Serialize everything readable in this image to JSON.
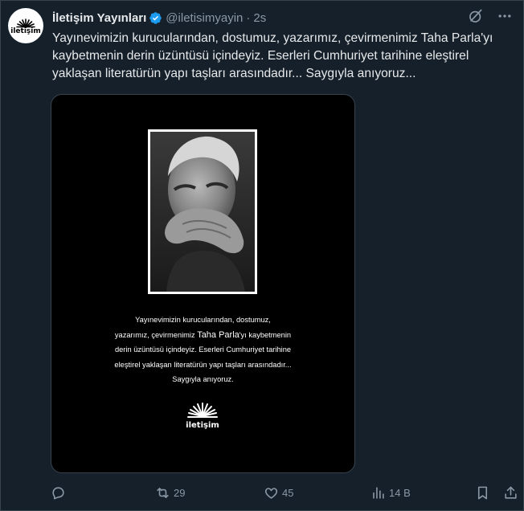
{
  "author": {
    "display_name": "İletişim Yayınları",
    "handle": "@iletisimyayin",
    "separator": "·",
    "time": "2s",
    "avatar_label": "iletişim"
  },
  "tweet": {
    "text": "Yayınevimizin kurucularından, dostumuz, yazarımız, çevirmenimiz Taha Parla'yı kaybetmenin derin üzüntüsü içindeyiz. Eserleri Cumhuriyet tarihine eleştirel yaklaşan literatürün yapı taşları arasındadır... Saygıyla anıyoruz..."
  },
  "media": {
    "caption_line1": "Yayınevimizin kurucularından, dostumuz,",
    "caption_line2_pre": "yazarımız, çevirmenimiz ",
    "caption_line2_name": "Taha Parla",
    "caption_line2_post": "'yı kaybetmenin",
    "caption_line3": "derin üzüntüsü içindeyiz. Eserleri Cumhuriyet tarihine",
    "caption_line4": "eleştirel yaklaşan literatürün yapı taşları arasındadır...",
    "caption_line5": "Saygıyla anıyoruz.",
    "logo_label": "iletişim"
  },
  "actions": {
    "replies": "",
    "retweets": "29",
    "likes": "45",
    "views": "14 B"
  },
  "icons": {
    "verified": "verified-badge-icon",
    "grok": "grok-icon",
    "more": "more-icon",
    "reply": "reply-icon",
    "retweet": "retweet-icon",
    "like": "heart-icon",
    "views": "views-icon",
    "bookmark": "bookmark-icon",
    "share": "share-icon"
  },
  "colors": {
    "background": "#15202b",
    "text": "#e7e9ea",
    "muted": "#8b98a5",
    "verified": "#1d9bf0",
    "border": "#38444d"
  }
}
